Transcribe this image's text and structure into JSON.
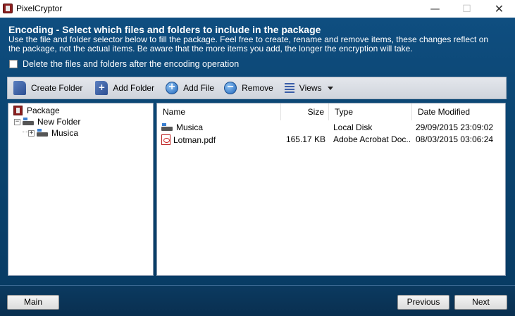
{
  "window": {
    "title": "PixelCryptor",
    "minimize_glyph": "—",
    "maximize_glyph": "☐",
    "close_glyph": "✕"
  },
  "header": {
    "heading": "Encoding - Select which files and folders to include in the package",
    "description": "Use the file and folder selector below to fill the package. Feel free to create, rename and remove items, these changes reflect on the package, not the actual items. Be aware that the more items you add, the longer the encryption will take."
  },
  "options": {
    "delete_after_label": "Delete the files and folders after the encoding operation",
    "delete_after_checked": false
  },
  "toolbar": {
    "create_folder": "Create Folder",
    "add_folder": "Add Folder",
    "add_file": "Add File",
    "remove": "Remove",
    "views": "Views"
  },
  "tree": {
    "root": "Package",
    "children": [
      {
        "label": "New Folder",
        "expander": "−"
      },
      {
        "label": "Musica",
        "expander": "+"
      }
    ]
  },
  "list": {
    "columns": [
      "Name",
      "Size",
      "Type",
      "Date Modified"
    ],
    "rows": [
      {
        "name": "Musica",
        "size": "",
        "type": "Local Disk",
        "date": "29/09/2015 23:09:02",
        "icon": "drive-icon"
      },
      {
        "name": "Lotman.pdf",
        "size": "165.17 KB",
        "type": "Adobe Acrobat Doc...",
        "date": "08/03/2015 03:06:24",
        "icon": "pdf-icon"
      }
    ]
  },
  "footer": {
    "main": "Main",
    "previous": "Previous",
    "next": "Next"
  }
}
